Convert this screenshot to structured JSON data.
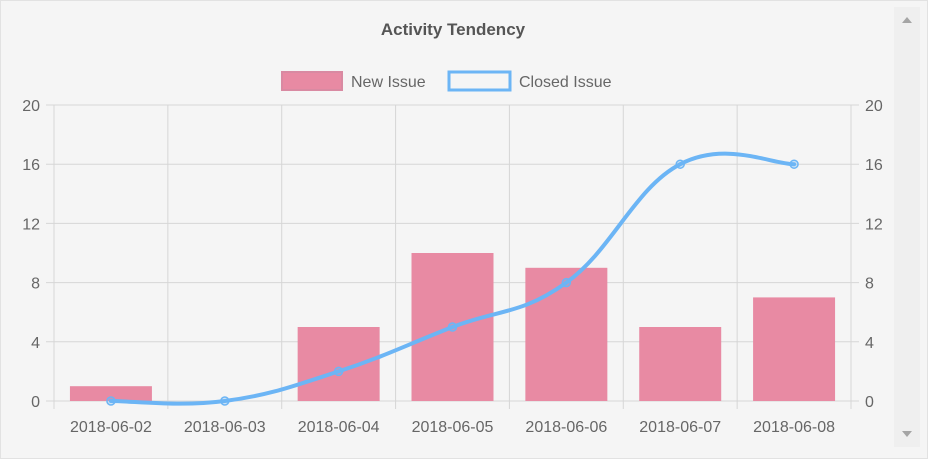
{
  "chart_data": {
    "type": "bar",
    "title": "Activity Tendency",
    "categories": [
      "2018-06-02",
      "2018-06-03",
      "2018-06-04",
      "2018-06-05",
      "2018-06-06",
      "2018-06-07",
      "2018-06-08"
    ],
    "series": [
      {
        "name": "New Issue",
        "type": "bar",
        "values": [
          1,
          0,
          5,
          10,
          9,
          5,
          7
        ],
        "color": "#e88aa3"
      },
      {
        "name": "Closed Issue",
        "type": "line",
        "values": [
          0,
          0,
          2,
          5,
          8,
          16,
          16
        ],
        "color": "#6cb5f5"
      }
    ],
    "ylim": [
      0,
      20
    ],
    "yticks": [
      0,
      4,
      8,
      12,
      16,
      20
    ],
    "y2ticks": [
      0,
      4,
      8,
      12,
      16,
      20
    ],
    "legend_position": "top",
    "grid": true
  },
  "colors": {
    "bar_fill": "#e88aa3",
    "bar_legend_border": "#d98aa2",
    "line_stroke": "#6cb5f5",
    "grid": "#d6d6d6",
    "background": "#f5f5f5"
  }
}
